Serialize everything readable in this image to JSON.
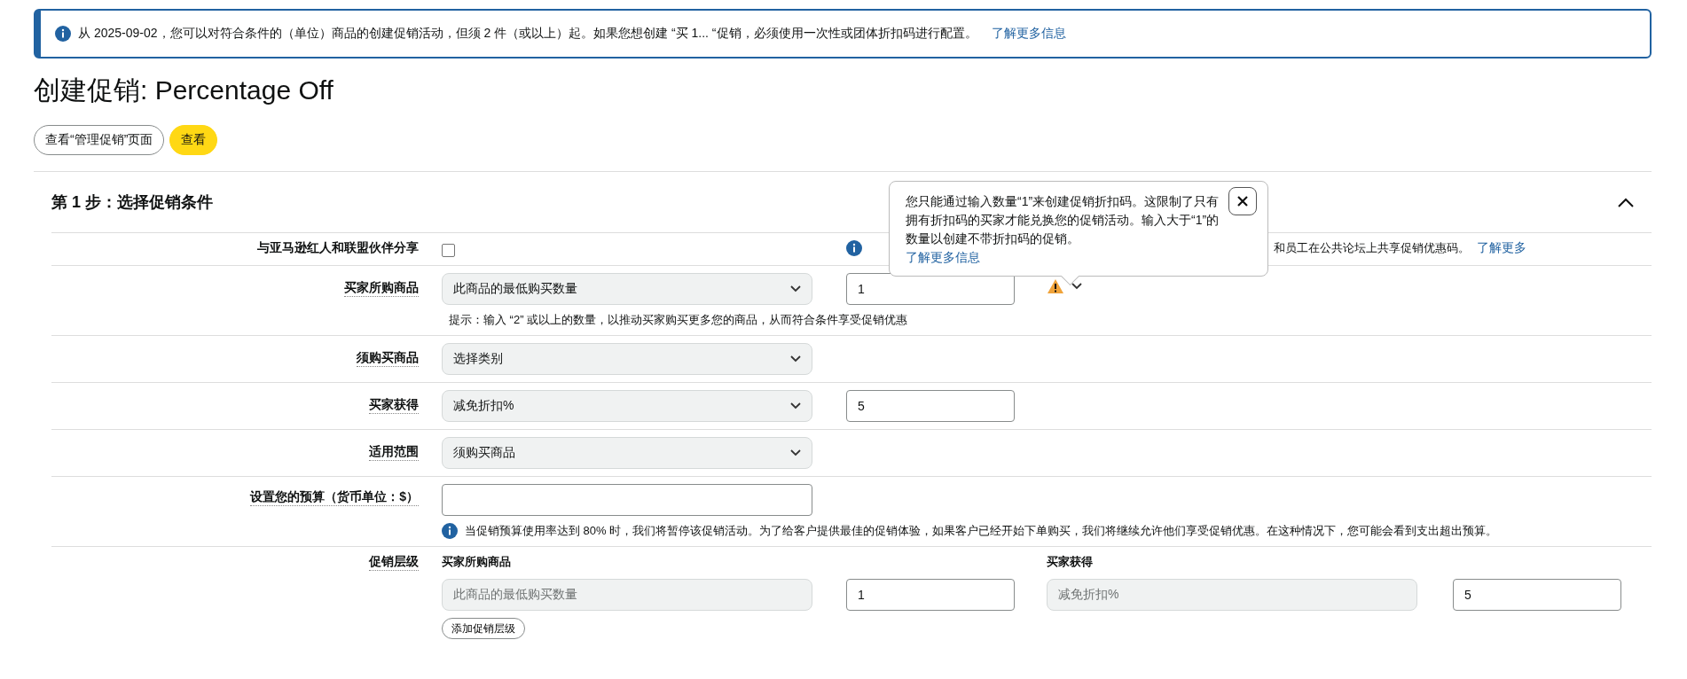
{
  "banner": {
    "text": "从 2025-09-02，您可以对符合条件的（单位）商品的创建促销活动，但须 2 件（或以上）起。如果您想创建 “买 1... “促销，必须使用一次性或团体折扣码进行配置。",
    "link": "了解更多信息"
  },
  "title": "创建促销: Percentage Off",
  "buttons": [
    {
      "label": "查看“管理促销”页面",
      "kind": "secondary"
    },
    {
      "label": "查看",
      "kind": "primary"
    }
  ],
  "section": {
    "title": "第 1 步：选择促销条件",
    "expanded": true,
    "rows": [
      {
        "kind": "checkbox",
        "label": "与亚马逊红人和联盟伙伴分享",
        "checked": false,
        "hint": {
          "text": "和员工在公共论坛上共享促销优惠码。",
          "link": "了解更多"
        }
      },
      {
        "kind": "select",
        "label": "买家所购商品",
        "select": "此商品的最低购买数量",
        "value": "1",
        "warning": true,
        "hint": {
          "text": "提示：输入 “2” 或以上的数量，以推动买家购买更多您的商品，从而符合条件享受促销优惠"
        }
      },
      {
        "kind": "select",
        "label": "须购买商品",
        "select": "选择类别"
      },
      {
        "kind": "select",
        "label": "买家获得",
        "select": "减免折扣%",
        "value": "5"
      },
      {
        "kind": "select",
        "label": "适用范围",
        "select": "须购买商品"
      },
      {
        "kind": "input",
        "label": "设置您的预算（货币单位：$）",
        "hint": {
          "text": "当促销预算使用率达到 80% 时，我们将暂停该促销活动。为了给客户提供最佳的促销体验，如果客户已经开始下单购买，我们将继续允许他们享受促销优惠。在这种情况下，您可能会看到支出超出预算。"
        }
      },
      {
        "kind": "tiers",
        "label": "促销层级",
        "headers": [
          "买家所购商品",
          "买家获得"
        ],
        "tiers": [
          {
            "buy_select": "此商品的最低购买数量",
            "buy_value": "1",
            "get_select": "减免折扣%",
            "get_value": "5",
            "disabled": true
          }
        ],
        "button": "添加促销层级"
      }
    ]
  },
  "tooltip": {
    "text": "您只能通过输入数量“1”来创建促销折扣码。这限制了只有拥有折扣码的买家才能兑换您的促销活动。输入大于“1”的数量以创建不带折扣码的促销。",
    "link": "了解更多信息"
  }
}
